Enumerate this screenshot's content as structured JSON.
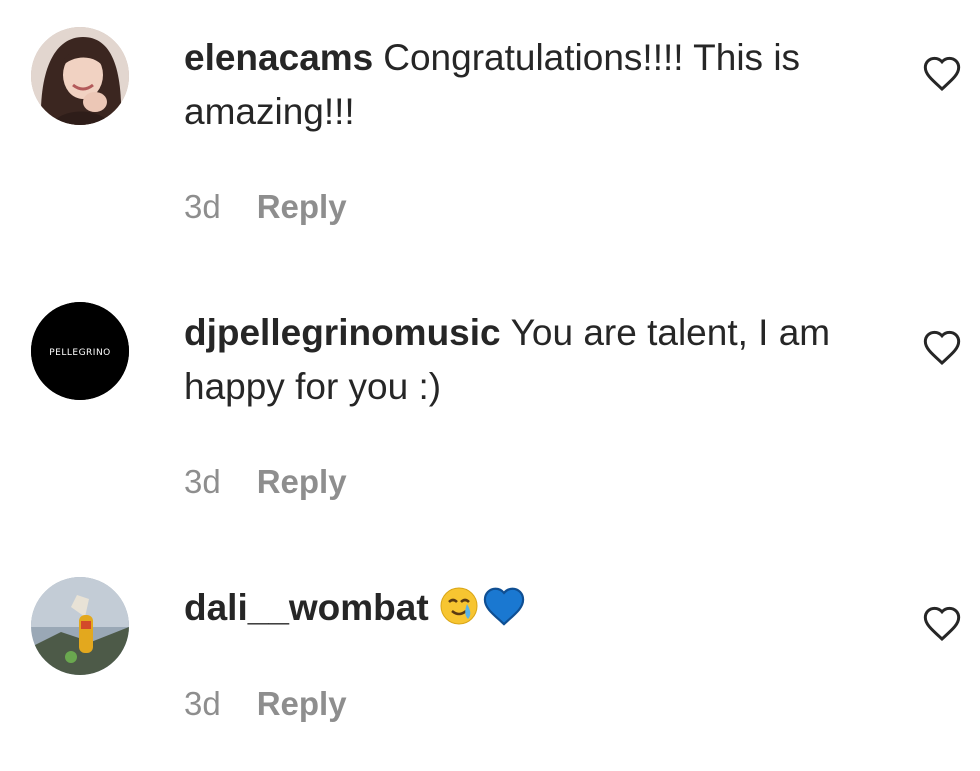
{
  "comments": [
    {
      "username": "elenacams",
      "text": "Congratulations!!!! This is amazing!!!",
      "time": "3d",
      "reply_label": "Reply",
      "avatar": "woman-portrait-avatar",
      "like_icon": "heart-outline-icon"
    },
    {
      "username": "djpellegrinomusic",
      "text": "You are talent, I am happy for you :)",
      "time": "3d",
      "reply_label": "Reply",
      "avatar": "pellegrino-logo-avatar",
      "avatar_logo_text": "PELLEGRINO",
      "like_icon": "heart-outline-icon"
    },
    {
      "username": "dali__wombat",
      "text": "",
      "emojis": [
        "crying-smile-emoji",
        "blue-heart-emoji"
      ],
      "time": "3d",
      "reply_label": "Reply",
      "avatar": "wombat-illustration-avatar",
      "like_icon": "heart-outline-icon"
    }
  ],
  "colors": {
    "text_primary": "#262626",
    "text_secondary": "#8e8e8e",
    "background": "#ffffff",
    "blue_heart": "#1a78d1"
  }
}
